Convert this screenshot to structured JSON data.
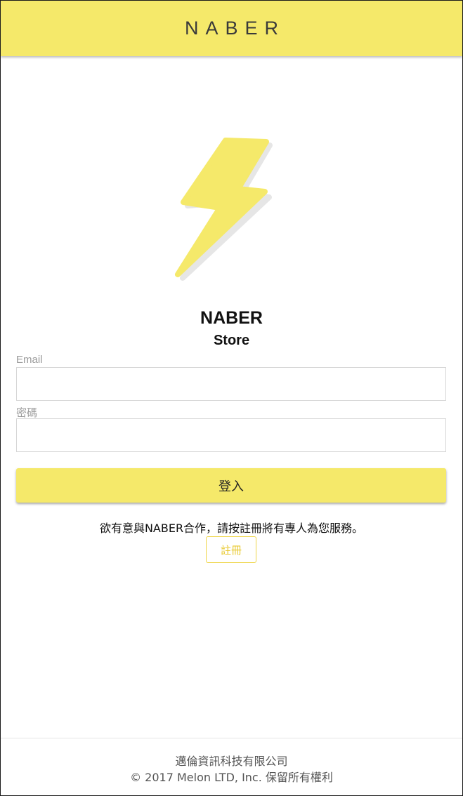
{
  "header": {
    "title": "NABER"
  },
  "logo": {
    "icon": "lightning-bolt-icon",
    "color": "#f5e96a"
  },
  "brand": {
    "name": "NABER",
    "subtitle": "Store"
  },
  "form": {
    "email_label": "Email",
    "email_value": "",
    "password_label": "密碼",
    "password_value": "",
    "login_label": "登入"
  },
  "signup": {
    "prompt": "欲有意與NABER合作，請按註冊將有專人為您服務。",
    "register_label": "註冊"
  },
  "footer": {
    "company": "邁倫資訊科技有限公司",
    "copyright": "© 2017 Melon LTD, Inc. 保留所有權利"
  },
  "colors": {
    "accent": "#f5e96a",
    "register_text": "#e8c82c"
  }
}
